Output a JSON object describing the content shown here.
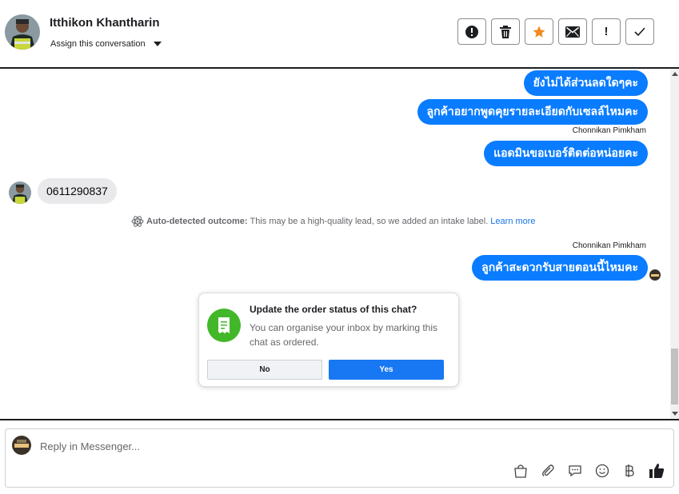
{
  "header": {
    "contact_name": "Itthikon Khantharin",
    "assign_label": "Assign this conversation",
    "actions": [
      {
        "icon": "alert-circle-icon"
      },
      {
        "icon": "trash-icon"
      },
      {
        "icon": "star-icon",
        "color": "#f28a1d"
      },
      {
        "icon": "envelope-icon"
      },
      {
        "icon": "exclamation-icon",
        "label": "!"
      },
      {
        "icon": "checkmark-icon"
      }
    ]
  },
  "thread": {
    "messages": [
      {
        "direction": "out",
        "text": "ยังไม่ได้ส่วนลดใดๆคะ"
      },
      {
        "direction": "out",
        "text": "ลูกค้าอยากพูดคุยรายละเอียดกับเซลล์ไหมคะ"
      },
      {
        "direction": "out",
        "sender": "Chonnikan Pimkham",
        "text": "แอดมินขอเบอร์ติดต่อหน่อยคะ"
      },
      {
        "direction": "in",
        "text": "0611290837"
      },
      {
        "direction": "out",
        "sender": "Chonnikan Pimkham",
        "text": "ลูกค้าสะดวกรับสายตอนนี้ไหมคะ"
      }
    ],
    "outcome": {
      "label": "Auto-detected outcome:",
      "text": "This may be a high-quality lead, so we added an intake label.",
      "link": "Learn more"
    }
  },
  "order_card": {
    "title": "Update the order status of this chat?",
    "description": "You can organise your inbox by marking this chat as ordered.",
    "no_label": "No",
    "yes_label": "Yes"
  },
  "composer": {
    "placeholder": "Reply in Messenger...",
    "tools": [
      "shopping-bag-icon",
      "paperclip-icon",
      "chat-bubble-icon",
      "smiley-icon",
      "baht-icon",
      "thumbs-up-icon"
    ]
  },
  "colors": {
    "accent": "#0a7cff",
    "button_blue": "#1877f2",
    "green": "#42b72a"
  }
}
